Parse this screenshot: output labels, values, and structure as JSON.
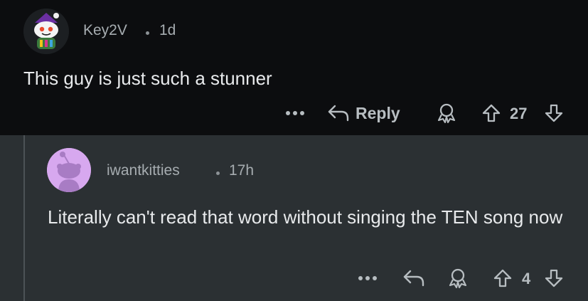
{
  "colors": {
    "top_comment_bg": "#0c0d0f",
    "reply_bg": "#2b3033",
    "text_primary": "#e8eaec",
    "text_muted": "#a6acb0",
    "action_color": "#b7bdc1",
    "reply_avatar_bg": "#d7a8ef"
  },
  "top_comment": {
    "username": "Key2V",
    "time": "1d",
    "text": "This guy is just such a stunner",
    "more_icon": "ellipsis-icon",
    "reply_label": "Reply",
    "votes": "27"
  },
  "reply_comment": {
    "username": "iwantkitties",
    "time": "17h",
    "text": "Literally can't read that word without singing the TEN song now",
    "more_icon": "ellipsis-icon",
    "votes": "4"
  }
}
